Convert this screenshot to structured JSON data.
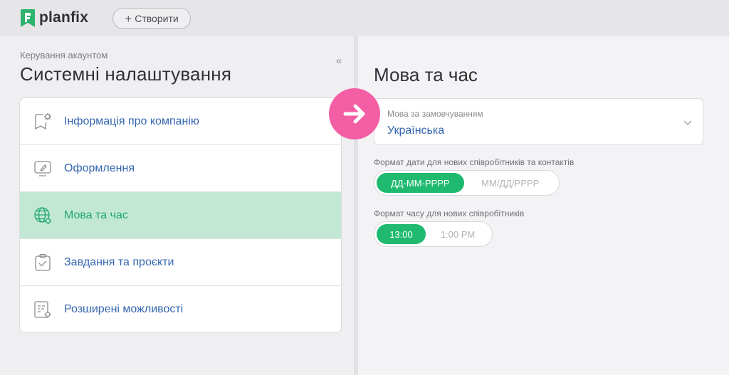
{
  "app": {
    "brand": "planfix",
    "create_button": "Створити",
    "create_plus": "+"
  },
  "sidebar": {
    "breadcrumb": "Керування акаунтом",
    "title": "Системні налаштування",
    "collapse_glyph": "«",
    "items": [
      {
        "label": "Інформація про компанію",
        "icon": "company-info-icon",
        "active": false
      },
      {
        "label": "Оформлення",
        "icon": "appearance-icon",
        "active": false
      },
      {
        "label": "Мова та час",
        "icon": "globe-gear-icon",
        "active": true
      },
      {
        "label": "Завдання та проєкти",
        "icon": "clipboard-check-icon",
        "active": false
      },
      {
        "label": "Розширені можливості",
        "icon": "advanced-settings-icon",
        "active": false
      }
    ]
  },
  "main": {
    "title": "Мова та час",
    "language": {
      "label": "Мова за замовчуванням",
      "value": "Українська"
    },
    "date_format": {
      "label": "Формат дати для нових співробітників та контактів",
      "options": [
        "ДД-ММ-РРРР",
        "ММ/ДД/РРРР"
      ],
      "selected": 0
    },
    "time_format": {
      "label": "Формат часу для нових співробітників",
      "options": [
        "13:00",
        "1:00 PM"
      ],
      "selected": 0
    }
  },
  "colors": {
    "accent_green": "#1fba6f",
    "active_row": "#c2e8d5",
    "link_blue": "#3567b0",
    "annotation_pink": "#f35ea4"
  }
}
